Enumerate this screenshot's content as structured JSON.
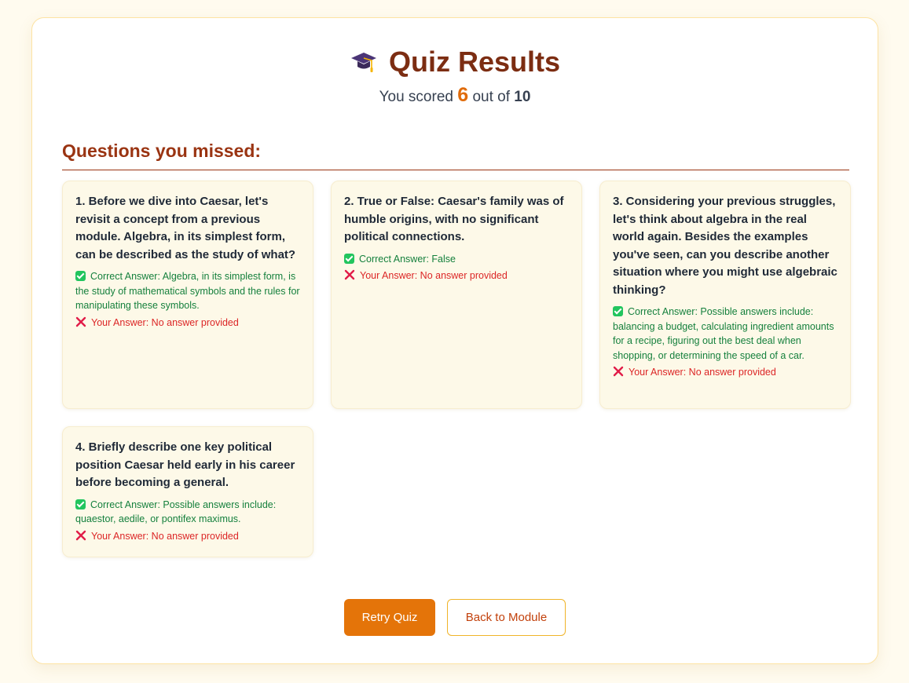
{
  "header": {
    "icon": "graduation-cap-icon",
    "title": "Quiz Results",
    "score_prefix": "You scored",
    "score": "6",
    "score_mid": "out of",
    "total": "10"
  },
  "missed": {
    "heading": "Questions you missed:",
    "items": [
      {
        "question": "1. Before we dive into Caesar, let's revisit a concept from a previous module. Algebra, in its simplest form, can be described as the study of what?",
        "correct": "Correct Answer: Algebra, in its simplest form, is the study of mathematical symbols and the rules for manipulating these symbols.",
        "yours": "Your Answer: No answer provided"
      },
      {
        "question": "2. True or False: Caesar's family was of humble origins, with no significant political connections.",
        "correct": "Correct Answer: False",
        "yours": "Your Answer: No answer provided"
      },
      {
        "question": "3. Considering your previous struggles, let's think about algebra in the real world again. Besides the examples you've seen, can you describe another situation where you might use algebraic thinking?",
        "correct": "Correct Answer: Possible answers include: balancing a budget, calculating ingredient amounts for a recipe, figuring out the best deal when shopping, or determining the speed of a car.",
        "yours": "Your Answer: No answer provided"
      },
      {
        "question": "4. Briefly describe one key political position Caesar held early in his career before becoming a general.",
        "correct": "Correct Answer: Possible answers include: quaestor, aedile, or pontifex maximus.",
        "yours": "Your Answer: No answer provided"
      }
    ]
  },
  "actions": {
    "retry_label": "Retry Quiz",
    "back_label": "Back to Module"
  },
  "colors": {
    "accent": "#e47409",
    "heading": "#7c2d12",
    "correct": "#15803d",
    "wrong": "#dc2626"
  }
}
